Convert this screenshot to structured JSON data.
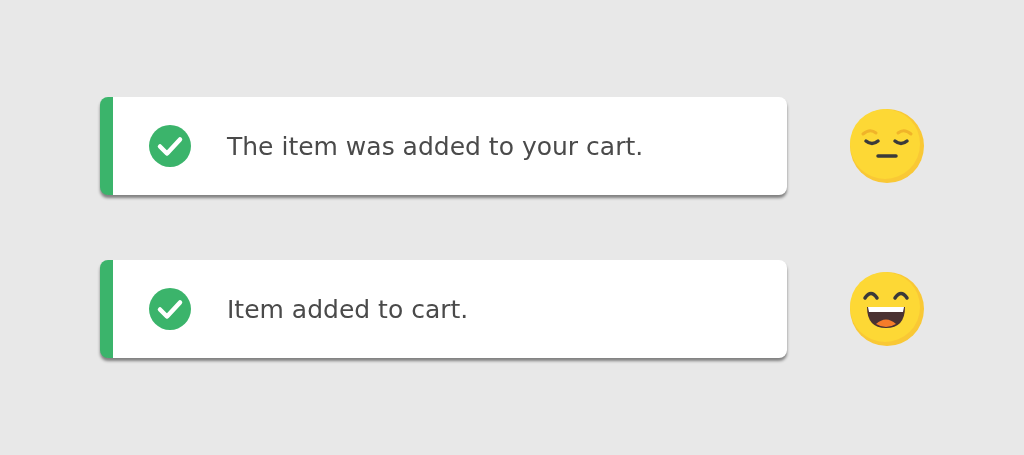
{
  "toasts": [
    {
      "message": "The item was added to your cart.",
      "reaction": {
        "kind": "pensive"
      }
    },
    {
      "message": "Item added to cart.",
      "reaction": {
        "kind": "grinning"
      }
    }
  ]
}
